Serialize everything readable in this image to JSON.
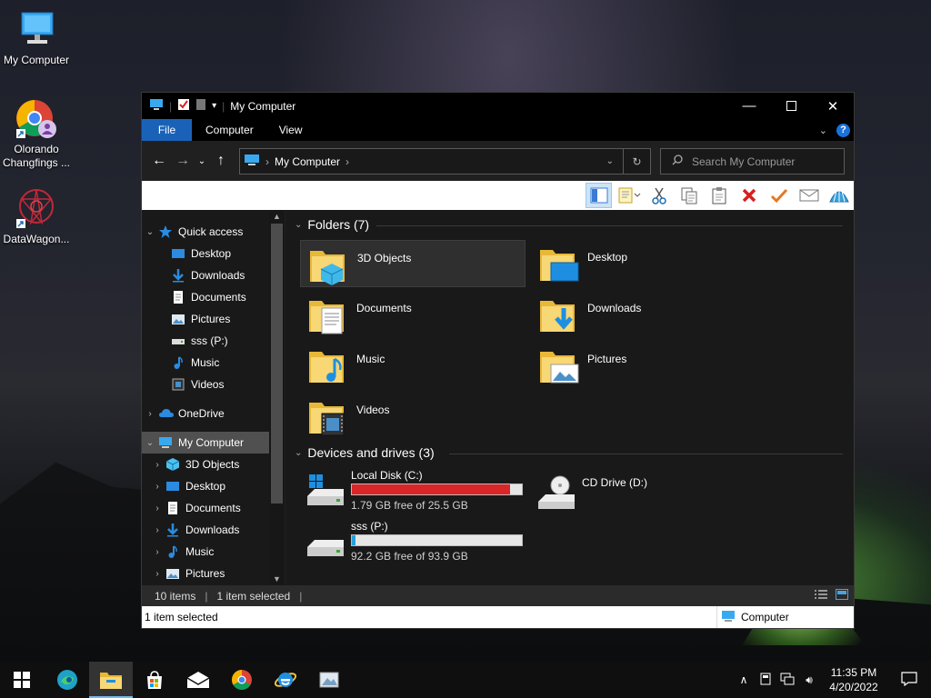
{
  "desktop": {
    "icons": [
      {
        "label": "My Computer"
      },
      {
        "label": "Olorando Changfings ..."
      },
      {
        "label": "DataWagon..."
      }
    ]
  },
  "window": {
    "title": "My Computer",
    "tabs": {
      "file": "File",
      "computer": "Computer",
      "view": "View"
    },
    "help": "?",
    "address": {
      "crumb": "My Computer"
    },
    "search_placeholder": "Search My Computer"
  },
  "nav": {
    "quick_access": "Quick access",
    "quick_items": [
      "Desktop",
      "Downloads",
      "Documents",
      "Pictures",
      "sss (P:)",
      "Music",
      "Videos"
    ],
    "onedrive": "OneDrive",
    "this_pc": "My Computer",
    "pc_items": [
      "3D Objects",
      "Desktop",
      "Documents",
      "Downloads",
      "Music",
      "Pictures"
    ]
  },
  "content": {
    "folders_header": "Folders (7)",
    "folders": [
      "3D Objects",
      "Desktop",
      "Documents",
      "Downloads",
      "Music",
      "Pictures",
      "Videos"
    ],
    "drives_header": "Devices and drives (3)",
    "drives": [
      {
        "name": "Local Disk (C:)",
        "free": "1.79 GB free of 25.5 GB",
        "used_fraction": 0.93,
        "bar_color": "#da2626"
      },
      {
        "name": "CD Drive (D:)"
      },
      {
        "name": "sss (P:)",
        "free": "92.2 GB free of 93.9 GB",
        "used_fraction": 0.02,
        "bar_color": "#26a0da"
      }
    ]
  },
  "status": {
    "items": "10 items",
    "selected": "1 item selected"
  },
  "infobar": {
    "text": "1 item selected",
    "zone": "Computer"
  },
  "taskbar": {
    "time": "11:35 PM",
    "date": "4/20/2022"
  },
  "colors": {
    "accent": "#1a62b8",
    "selection": "#505050"
  }
}
